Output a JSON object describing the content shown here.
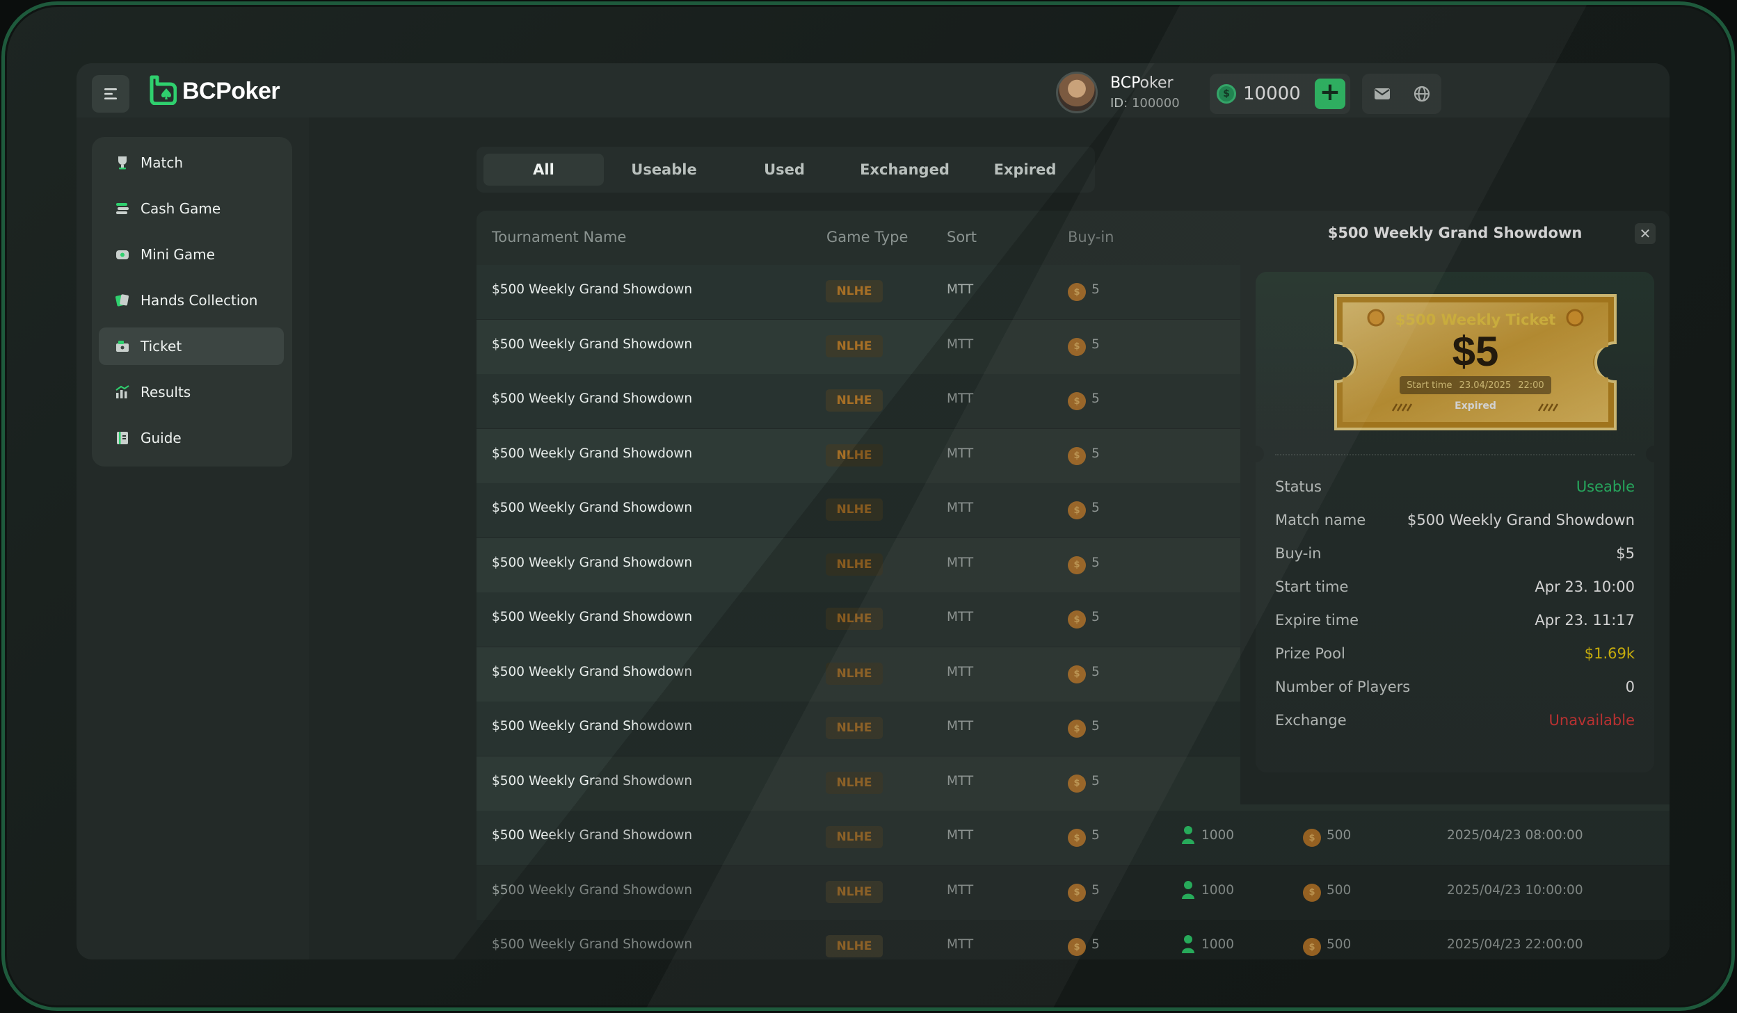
{
  "header": {
    "brand": "BCPoker",
    "user_name": "BCPoker",
    "user_id": "ID: 100000",
    "balance": "10000",
    "coin_symbol": "$",
    "plus_label": "+"
  },
  "sidebar": {
    "items": [
      {
        "label": "Match",
        "icon": "trophy-icon"
      },
      {
        "label": "Cash Game",
        "icon": "chips-stack-icon"
      },
      {
        "label": "Mini Game",
        "icon": "gamepad-icon"
      },
      {
        "label": "Hands Collection",
        "icon": "cards-icon"
      },
      {
        "label": "Ticket",
        "icon": "ticket-icon"
      },
      {
        "label": "Results",
        "icon": "chart-icon"
      },
      {
        "label": "Guide",
        "icon": "book-icon"
      }
    ],
    "active": "Ticket"
  },
  "tabs": [
    "All",
    "Useable",
    "Used",
    "Exchanged",
    "Expired"
  ],
  "active_tab": "All",
  "table": {
    "headers": [
      "Tournament Name",
      "Game Type",
      "Sort",
      "Buy-in"
    ],
    "rows": [
      {
        "name": "$500 Weekly Grand Showdown",
        "type": "NLHE",
        "sort": "MTT",
        "buyin": "5"
      },
      {
        "name": "$500 Weekly Grand Showdown",
        "type": "NLHE",
        "sort": "MTT",
        "buyin": "5"
      },
      {
        "name": "$500 Weekly Grand Showdown",
        "type": "NLHE",
        "sort": "MTT",
        "buyin": "5"
      },
      {
        "name": "$500 Weekly Grand Showdown",
        "type": "NLHE",
        "sort": "MTT",
        "buyin": "5"
      },
      {
        "name": "$500 Weekly Grand Showdown",
        "type": "NLHE",
        "sort": "MTT",
        "buyin": "5"
      },
      {
        "name": "$500 Weekly Grand Showdown",
        "type": "NLHE",
        "sort": "MTT",
        "buyin": "5"
      },
      {
        "name": "$500 Weekly Grand Showdown",
        "type": "NLHE",
        "sort": "MTT",
        "buyin": "5"
      },
      {
        "name": "$500 Weekly Grand Showdown",
        "type": "NLHE",
        "sort": "MTT",
        "buyin": "5"
      },
      {
        "name": "$500 Weekly Grand Showdown",
        "type": "NLHE",
        "sort": "MTT",
        "buyin": "5"
      },
      {
        "name": "$500 Weekly Grand Showdown",
        "type": "NLHE",
        "sort": "MTT",
        "buyin": "5"
      },
      {
        "name": "$500 Weekly Grand Showdown",
        "type": "NLHE",
        "sort": "MTT",
        "buyin": "5",
        "players": "1000",
        "prize": "500",
        "time": "2025/04/23 08:00:00"
      },
      {
        "name": "$500 Weekly Grand Showdown",
        "type": "NLHE",
        "sort": "MTT",
        "buyin": "5",
        "players": "1000",
        "prize": "500",
        "time": "2025/04/23 10:00:00"
      },
      {
        "name": "$500 Weekly Grand Showdown",
        "type": "NLHE",
        "sort": "MTT",
        "buyin": "5",
        "players": "1000",
        "prize": "500",
        "time": "2025/04/23 22:00:00"
      }
    ]
  },
  "detail": {
    "title": "$500 Weekly Grand Showdown",
    "close_label": "✕",
    "ticket": {
      "heading": "$500 Weekly Ticket",
      "price": "$5",
      "start_label": "Start time",
      "start_date": "23.04/2025",
      "start_time": "22:00",
      "status": "Expired"
    },
    "fields": [
      {
        "label": "Status",
        "value": "Useable",
        "color": "#2ecc71"
      },
      {
        "label": "Match name",
        "value": "$500 Weekly Grand Showdown"
      },
      {
        "label": "Buy-in",
        "value": "$5"
      },
      {
        "label": "Start time",
        "value": "Apr 23. 10:00"
      },
      {
        "label": "Expire time",
        "value": "Apr 23. 11:17"
      },
      {
        "label": "Prize Pool",
        "value": "$1.69k",
        "color": "#f1d20f"
      },
      {
        "label": "Number of Players",
        "value": "0"
      },
      {
        "label": "Exchange",
        "value": "Unavailable",
        "color": "#e23c3c"
      }
    ]
  },
  "colors": {
    "accent_green": "#2fd06e",
    "badge_text": "#a66f26",
    "gold": "#f1d20f",
    "danger": "#e23c3c"
  }
}
